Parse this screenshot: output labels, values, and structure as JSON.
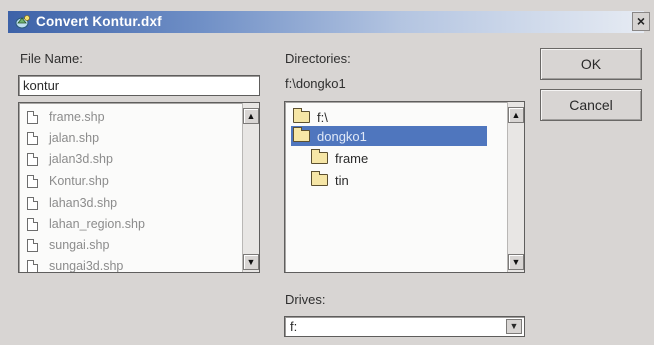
{
  "window": {
    "title": "Convert Kontur.dxf",
    "close_symbol": "×",
    "title_icon": "convert-icon"
  },
  "file_name": {
    "label": "File Name:",
    "value": "kontur",
    "files": [
      "frame.shp",
      "jalan.shp",
      "jalan3d.shp",
      "Kontur.shp",
      "lahan3d.shp",
      "lahan_region.shp",
      "sungai.shp",
      "sungai3d.shp"
    ]
  },
  "directories": {
    "label": "Directories:",
    "current_path": "f:\\dongko1",
    "items": [
      {
        "label": "f:\\",
        "icon": "open-folder-icon",
        "selected": false
      },
      {
        "label": "dongko1",
        "icon": "open-folder-icon",
        "selected": true
      },
      {
        "label": "frame",
        "icon": "folder-icon",
        "selected": false
      },
      {
        "label": "tin",
        "icon": "folder-icon",
        "selected": false
      }
    ]
  },
  "drives": {
    "label": "Drives:",
    "value": "f:"
  },
  "buttons": {
    "ok": "OK",
    "cancel": "Cancel"
  },
  "scroll": {
    "up_symbol": "▲",
    "down_symbol": "▼"
  },
  "colors": {
    "title_start": "#3d62a8",
    "title_end": "#e6ebf3",
    "selection": "#4f76be",
    "face": "#d8d5d3"
  }
}
